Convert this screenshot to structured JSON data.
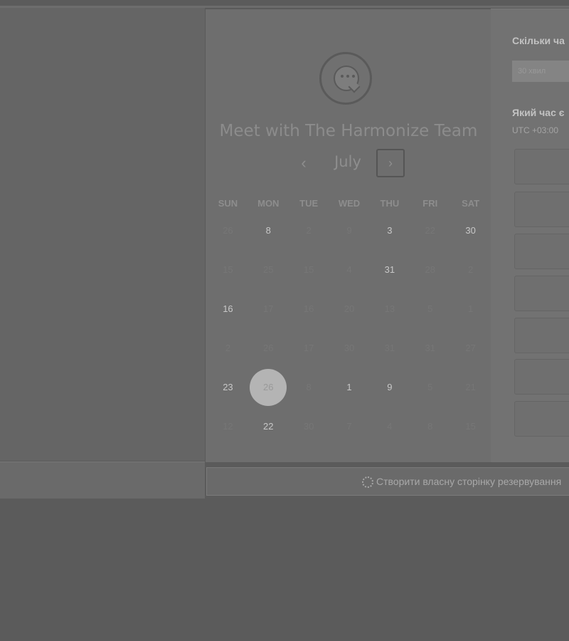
{
  "header": {
    "title": "Meet with The Harmonize Team",
    "logo_icon": "chat-bubble-logo"
  },
  "calendar": {
    "month": "July",
    "prev_icon": "chevron-left",
    "next_icon": "chevron-right",
    "prev_glyph": "‹",
    "next_glyph": "›",
    "weekdays": [
      "SUN",
      "MON",
      "TUE",
      "WED",
      "THU",
      "FRI",
      "SAT"
    ],
    "selected_day": "26",
    "weeks": [
      [
        {
          "d": "26",
          "a": false
        },
        {
          "d": "8",
          "a": true
        },
        {
          "d": "2",
          "a": false
        },
        {
          "d": "9",
          "a": false
        },
        {
          "d": "3",
          "a": true
        },
        {
          "d": "22",
          "a": false
        },
        {
          "d": "30",
          "a": true
        }
      ],
      [
        {
          "d": "15",
          "a": false
        },
        {
          "d": "25",
          "a": false
        },
        {
          "d": "15",
          "a": false
        },
        {
          "d": "4",
          "a": false
        },
        {
          "d": "31",
          "a": true
        },
        {
          "d": "28",
          "a": false
        },
        {
          "d": "2",
          "a": false
        }
      ],
      [
        {
          "d": "16",
          "a": true
        },
        {
          "d": "17",
          "a": false
        },
        {
          "d": "16",
          "a": false
        },
        {
          "d": "20",
          "a": false
        },
        {
          "d": "13",
          "a": false
        },
        {
          "d": "5",
          "a": false
        },
        {
          "d": "1",
          "a": false
        }
      ],
      [
        {
          "d": "2",
          "a": false
        },
        {
          "d": "26",
          "a": false
        },
        {
          "d": "17",
          "a": false
        },
        {
          "d": "30",
          "a": false
        },
        {
          "d": "31",
          "a": false
        },
        {
          "d": "31",
          "a": false
        },
        {
          "d": "27",
          "a": false
        }
      ],
      [
        {
          "d": "23",
          "a": true
        },
        {
          "d": "26",
          "a": false,
          "selected": true
        },
        {
          "d": "8",
          "a": false
        },
        {
          "d": "1",
          "a": true
        },
        {
          "d": "9",
          "a": true
        },
        {
          "d": "5",
          "a": false
        },
        {
          "d": "21",
          "a": false
        }
      ],
      [
        {
          "d": "12",
          "a": false
        },
        {
          "d": "22",
          "a": true
        },
        {
          "d": "30",
          "a": false
        },
        {
          "d": "7",
          "a": false
        },
        {
          "d": "4",
          "a": false
        },
        {
          "d": "8",
          "a": false
        },
        {
          "d": "15",
          "a": false
        }
      ]
    ]
  },
  "side_panel": {
    "duration_label": "Скільки ча",
    "duration_value": "30 хвил",
    "time_label": "Який час є",
    "timezone": "UTC +03:00"
  },
  "footer": {
    "link_text": "Створити власну сторінку резервування",
    "icon": "sparkle-icon"
  }
}
